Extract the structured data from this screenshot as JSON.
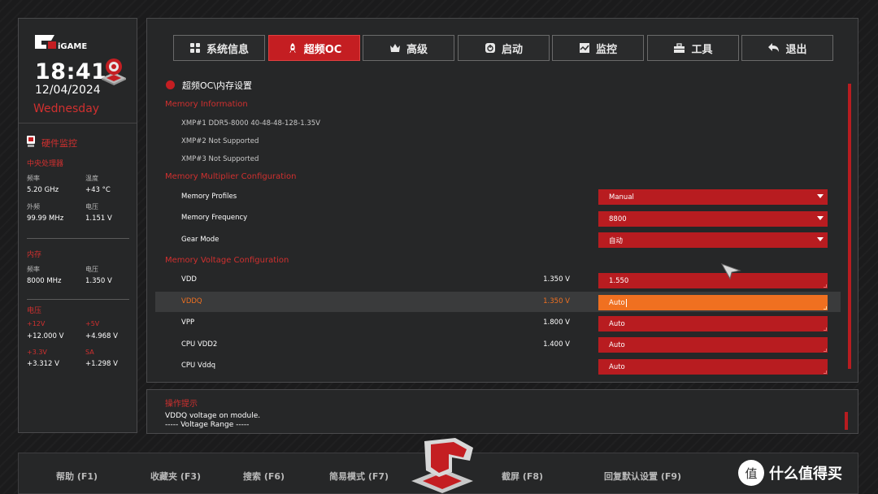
{
  "left_panel": {
    "brand": "iGAME",
    "time": "18:41",
    "date": "12/04/2024",
    "day": "Wednesday",
    "hw_monitor_title": "硬件监控",
    "cpu": {
      "title": "中央处理器",
      "freq_label": "频率",
      "freq": "5.20 GHz",
      "temp_label": "温度",
      "temp": "+43 °C",
      "bclk_label": "外频",
      "bclk": "99.99 MHz",
      "volt_label": "电压",
      "volt": "1.151 V"
    },
    "memory": {
      "title": "内存",
      "freq_label": "频率",
      "freq": "8000 MHz",
      "volt_label": "电压",
      "volt": "1.350 V"
    },
    "voltage": {
      "title": "电压",
      "v12_label": "+12V",
      "v12": "+12.000 V",
      "v5_label": "+5V",
      "v5": "+4.968 V",
      "v33_label": "+3.3V",
      "v33": "+3.312 V",
      "sa_label": "SA",
      "sa": "+1.298 V"
    }
  },
  "tabs": [
    {
      "label": "系统信息",
      "icon": "grid-icon"
    },
    {
      "label": "超频OC",
      "icon": "rocket-icon",
      "active": true
    },
    {
      "label": "高级",
      "icon": "crown-icon"
    },
    {
      "label": "启动",
      "icon": "power-icon"
    },
    {
      "label": "监控",
      "icon": "monitor-chart-icon"
    },
    {
      "label": "工具",
      "icon": "toolbox-icon"
    },
    {
      "label": "退出",
      "icon": "exit-arrow-icon"
    }
  ],
  "main": {
    "breadcrumb": "超频OC\\内存设置",
    "memory_info_title": "Memory Information",
    "xmp1": "XMP#1 DDR5-8000 40-48-48-128-1.35V",
    "xmp2": "XMP#2 Not Supported",
    "xmp3": "XMP#3 Not Supported",
    "multiplier_title": "Memory Multiplier Configuration",
    "profiles_label": "Memory Profiles",
    "profiles_value": "Manual",
    "frequency_label": "Memory Frequency",
    "frequency_value": "8800",
    "gear_label": "Gear Mode",
    "gear_value": "自动",
    "voltage_title": "Memory Voltage Configuration",
    "vdd_label": "VDD",
    "vdd_current": "1.350 V",
    "vdd_value": "1.550",
    "vddq_label": "VDDQ",
    "vddq_current": "1.350 V",
    "vddq_value": "Auto",
    "vpp_label": "VPP",
    "vpp_current": "1.800 V",
    "vpp_value": "Auto",
    "cpu_vdd2_label": "CPU VDD2",
    "cpu_vdd2_current": "1.400 V",
    "cpu_vdd2_value": "Auto",
    "cpu_vddq_label": "CPU Vddq",
    "cpu_vddq_value": "Auto"
  },
  "help": {
    "title": "操作提示",
    "line1": "VDDQ voltage on module.",
    "line2": "----- Voltage Range -----"
  },
  "footer": {
    "help": "帮助 (F1)",
    "favorites": "收藏夹 (F3)",
    "search": "搜索 (F6)",
    "easy_mode": "简易模式 (F7)",
    "screenshot": "截屏 (F8)",
    "restore_defaults": "回复默认设置 (F9)"
  },
  "watermark": {
    "badge": "值",
    "text": "什么值得买"
  },
  "colors": {
    "accent": "#c41e22",
    "highlight": "#f07020",
    "background": "#1b1b1c",
    "panel": "#262728"
  }
}
